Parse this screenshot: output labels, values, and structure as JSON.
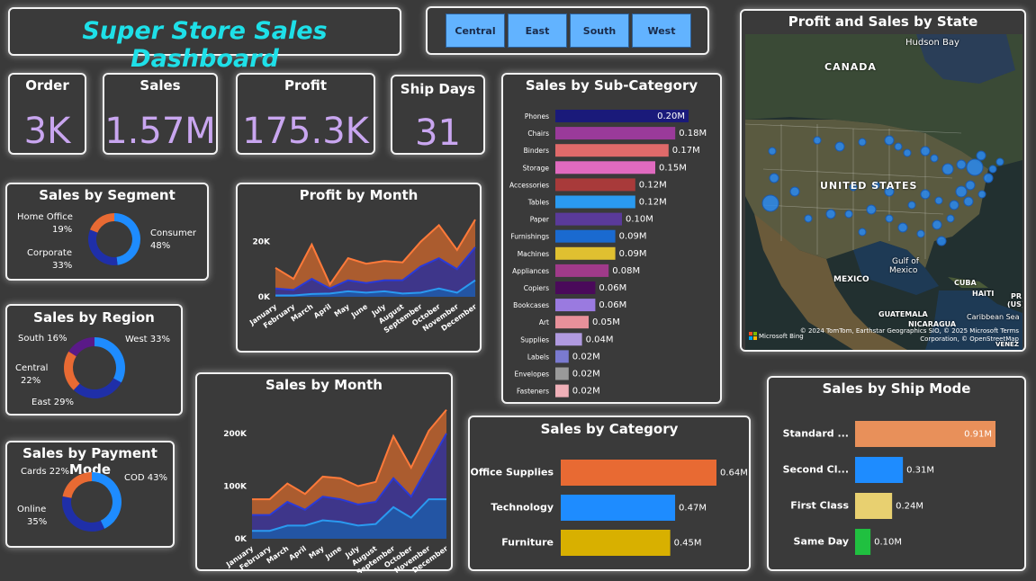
{
  "header": {
    "title": "Super Store Sales Dashboard"
  },
  "slicer": {
    "regions": [
      "Central",
      "East",
      "South",
      "West"
    ]
  },
  "kpis": {
    "order": {
      "label": "Order",
      "value": "3K"
    },
    "sales": {
      "label": "Sales",
      "value": "1.57M"
    },
    "profit": {
      "label": "Profit",
      "value": "175.3K"
    },
    "ship_days": {
      "label": "Ship Days",
      "value": "31"
    }
  },
  "segment": {
    "title": "Sales by Segment",
    "items": [
      {
        "name": "Home Office",
        "pct": "19%",
        "value": 19,
        "color": "#e86a33"
      },
      {
        "name": "Corporate",
        "pct": "33%",
        "value": 33,
        "color": "#1f2fa8"
      },
      {
        "name": "Consumer",
        "pct": "48%",
        "value": 48,
        "color": "#1e8cff"
      }
    ]
  },
  "region": {
    "title": "Sales by Region",
    "items": [
      {
        "name": "South",
        "pct": "16%",
        "value": 16,
        "color": "#5a1a88"
      },
      {
        "name": "West",
        "pct": "33%",
        "value": 33,
        "color": "#1e8cff"
      },
      {
        "name": "East",
        "pct": "29%",
        "value": 29,
        "color": "#1f2fa8"
      },
      {
        "name": "Central",
        "pct": "22%",
        "value": 22,
        "color": "#e86a33"
      }
    ]
  },
  "payment": {
    "title": "Sales by Payment Mode",
    "items": [
      {
        "name": "Cards",
        "pct": "22%",
        "value": 22,
        "color": "#e86a33"
      },
      {
        "name": "COD",
        "pct": "43%",
        "value": 43,
        "color": "#1e8cff"
      },
      {
        "name": "Online",
        "pct": "35%",
        "value": 35,
        "color": "#1f2fa8"
      }
    ]
  },
  "profit_month": {
    "title": "Profit by Month",
    "yticks": [
      "20K",
      "0K"
    ],
    "months": [
      "January",
      "February",
      "March",
      "April",
      "May",
      "June",
      "July",
      "August",
      "September",
      "October",
      "November",
      "December"
    ],
    "top": [
      10500,
      6500,
      19000,
      4500,
      14000,
      12000,
      13000,
      12500,
      20000,
      26000,
      17000,
      28000
    ],
    "mid": [
      3000,
      2500,
      6500,
      3000,
      6000,
      5000,
      6000,
      6000,
      11000,
      14000,
      10000,
      18000
    ],
    "low": [
      500,
      500,
      1000,
      1200,
      2000,
      1500,
      2000,
      1200,
      1500,
      3000,
      1500,
      6000
    ]
  },
  "sales_month": {
    "title": "Sales by Month",
    "yticks": [
      "200K",
      "100K",
      "0K"
    ],
    "months": [
      "January",
      "February",
      "March",
      "April",
      "May",
      "June",
      "July",
      "August",
      "September",
      "October",
      "November",
      "December"
    ],
    "top": [
      75000,
      75000,
      105000,
      85000,
      118000,
      115000,
      100000,
      108000,
      195000,
      135000,
      205000,
      245000
    ],
    "mid": [
      45000,
      45000,
      70000,
      55000,
      80000,
      75000,
      65000,
      70000,
      115000,
      80000,
      140000,
      200000
    ],
    "low": [
      15000,
      15000,
      25000,
      25000,
      35000,
      32000,
      25000,
      28000,
      60000,
      40000,
      75000,
      75000
    ]
  },
  "subcategory": {
    "title": "Sales by Sub-Category",
    "items": [
      {
        "name": "Phones",
        "label": "0.20M",
        "value": 0.2,
        "color": "#1a1a7a"
      },
      {
        "name": "Chairs",
        "label": "0.18M",
        "value": 0.18,
        "color": "#9a3a9a"
      },
      {
        "name": "Binders",
        "label": "0.17M",
        "value": 0.17,
        "color": "#e06a6a"
      },
      {
        "name": "Storage",
        "label": "0.15M",
        "value": 0.15,
        "color": "#e06abf"
      },
      {
        "name": "Accessories",
        "label": "0.12M",
        "value": 0.12,
        "color": "#a83a3a"
      },
      {
        "name": "Tables",
        "label": "0.12M",
        "value": 0.12,
        "color": "#2a9af0"
      },
      {
        "name": "Paper",
        "label": "0.10M",
        "value": 0.1,
        "color": "#5a3a9a"
      },
      {
        "name": "Furnishings",
        "label": "0.09M",
        "value": 0.09,
        "color": "#1a6ad0"
      },
      {
        "name": "Machines",
        "label": "0.09M",
        "value": 0.09,
        "color": "#e0c030"
      },
      {
        "name": "Appliances",
        "label": "0.08M",
        "value": 0.08,
        "color": "#a03a8a"
      },
      {
        "name": "Copiers",
        "label": "0.06M",
        "value": 0.06,
        "color": "#4a0a5a"
      },
      {
        "name": "Bookcases",
        "label": "0.06M",
        "value": 0.06,
        "color": "#9a7ae0"
      },
      {
        "name": "Art",
        "label": "0.05M",
        "value": 0.05,
        "color": "#e8909a"
      },
      {
        "name": "Supplies",
        "label": "0.04M",
        "value": 0.04,
        "color": "#b09ae0"
      },
      {
        "name": "Labels",
        "label": "0.02M",
        "value": 0.02,
        "color": "#7a7ad0"
      },
      {
        "name": "Envelopes",
        "label": "0.02M",
        "value": 0.02,
        "color": "#9a9a9a"
      },
      {
        "name": "Fasteners",
        "label": "0.02M",
        "value": 0.02,
        "color": "#f0b0b8"
      }
    ]
  },
  "category": {
    "title": "Sales by Category",
    "items": [
      {
        "name": "Office Supplies",
        "label": "0.64M",
        "value": 0.64,
        "color": "#e86a33"
      },
      {
        "name": "Technology",
        "label": "0.47M",
        "value": 0.47,
        "color": "#1e8cff"
      },
      {
        "name": "Furniture",
        "label": "0.45M",
        "value": 0.45,
        "color": "#d8b000"
      }
    ]
  },
  "shipmode": {
    "title": "Sales by Ship Mode",
    "items": [
      {
        "name": "Standard ...",
        "label": "0.91M",
        "value": 0.91,
        "color": "#e8905a"
      },
      {
        "name": "Second Cl...",
        "label": "0.31M",
        "value": 0.31,
        "color": "#1e8cff"
      },
      {
        "name": "First Class",
        "label": "0.24M",
        "value": 0.24,
        "color": "#e8d070"
      },
      {
        "name": "Same Day",
        "label": "0.10M",
        "value": 0.1,
        "color": "#20c040"
      }
    ]
  },
  "map": {
    "title": "Profit and Sales by State",
    "labels": {
      "hudson_bay": "Hudson Bay",
      "canada": "CANADA",
      "united_states": "UNITED STATES",
      "gulf": "Gulf of",
      "mexico_gulf": "Mexico",
      "mexico": "MEXICO",
      "cuba": "CUBA",
      "haiti": "HAITI",
      "pr": "PR",
      "us": "(US)",
      "guatemala": "GUATEMALA",
      "nicaragua": "NICARAGUA",
      "caribbean": "Caribbean Sea",
      "venezuela": "VENEZ"
    },
    "attribution": "© 2024 TomTom, Earthstar Geographics SIO, © 2025 Microsoft Terms",
    "attribution2": "Corporation, © OpenStreetMap",
    "bing": "Microsoft Bing"
  }
}
